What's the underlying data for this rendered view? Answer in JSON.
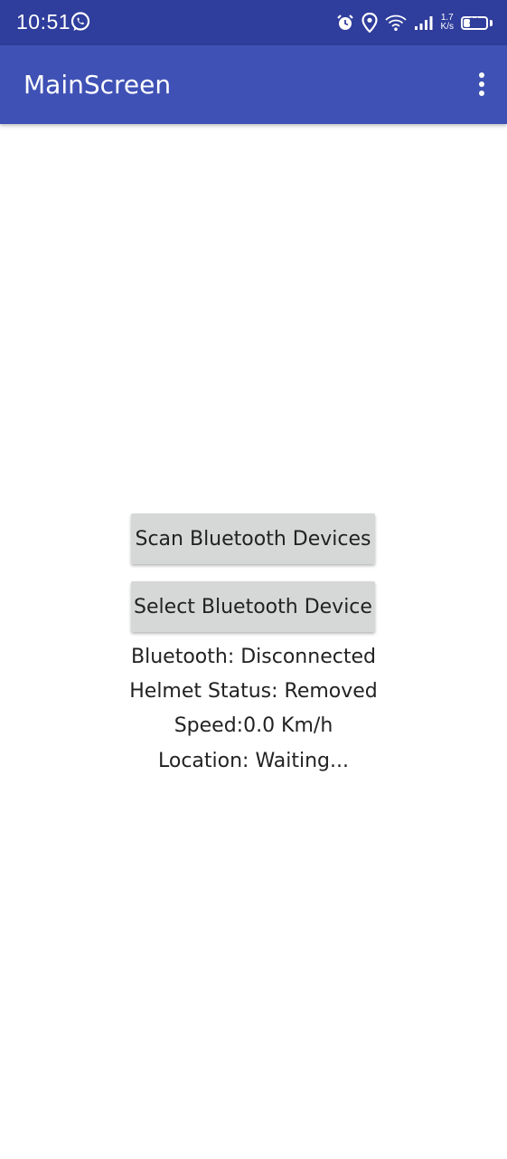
{
  "status_bar": {
    "time": "10:51",
    "net_speed_value": "1.7",
    "net_speed_unit": "K/s",
    "battery": "31",
    "battery_level": 0.31,
    "icons": [
      "whatsapp-icon",
      "alarm-icon",
      "location-icon",
      "wifi-icon",
      "signal-icon",
      "battery-icon"
    ]
  },
  "app_bar": {
    "title": "MainScreen",
    "menu_icon": "overflow-menu-icon"
  },
  "main": {
    "scan_button": "Scan Bluetooth Devices",
    "select_button": "Select Bluetooth Device",
    "bluetooth_status": "Bluetooth: Disconnected",
    "helmet_status": "Helmet Status: Removed",
    "speed": "Speed:0.0 Km/h",
    "location": "Location: Waiting..."
  },
  "colors": {
    "status_bar": "#2f3d9c",
    "app_bar": "#3f51b5",
    "button": "#d6d7d7",
    "text": "#222222"
  }
}
